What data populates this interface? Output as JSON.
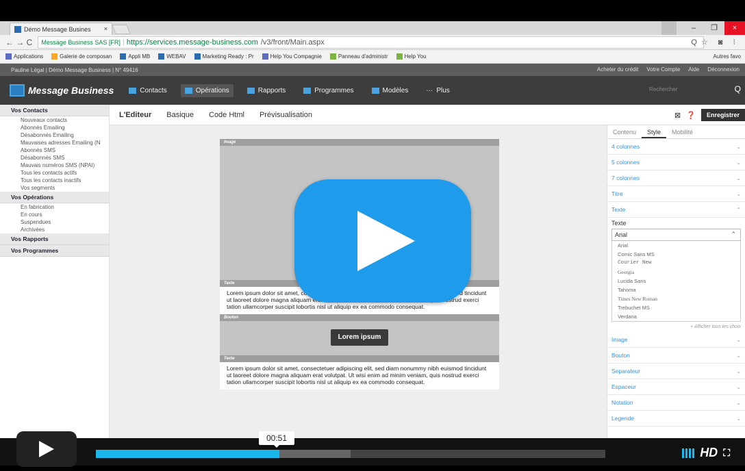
{
  "browser": {
    "tab_title": "Démo Message Busines",
    "tab_close": "×",
    "url_secure": "Message Business SAS [FR]",
    "url_host": "https://services.message-business.com",
    "url_path": "/v3/front/Main.aspx",
    "nav_icons": "← → C",
    "right_icons": "Q☆ ◙ ⁝",
    "bookmarks": [
      "Applications",
      "Galerie de composan",
      "Appli MB",
      "WEBAV",
      "Marketing Ready : Pr",
      "Help You Compagnie",
      "Panneau d'administr",
      "Help You"
    ],
    "bookmarks_right": "Autres favo",
    "win_min": "–",
    "win_max": "❐",
    "win_close": "×"
  },
  "app": {
    "info_left": "Pauline Légal | Démo Message Business | N° 49416",
    "info_credit": "Acheter du crédit",
    "info_account": "Votre Compte",
    "info_help": "Aide",
    "info_logout": "Déconnexion",
    "logo": "Message Business",
    "nav": [
      "Contacts",
      "Opérations",
      "Rapports",
      "Programmes",
      "Modèles",
      "Plus"
    ],
    "search_placeholder": "Rechercher"
  },
  "sidebar": {
    "groups": [
      {
        "title": "Vos Contacts",
        "items": [
          "Nouveaux contacts",
          "Abonnés Emailing",
          "Désabonnés Emailing",
          "Mauvaises adresses Emailing (N",
          "Abonnés SMS",
          "Désabonnés SMS",
          "Mauvais numéros SMS (NPAI)",
          "Tous les contacts actifs",
          "Tous les contacts inactifs",
          "Vos segments"
        ]
      },
      {
        "title": "Vos Opérations",
        "items": [
          "En fabrication",
          "En cours",
          "Suspendues",
          "Archivées"
        ]
      },
      {
        "title": "Vos Rapports",
        "items": []
      },
      {
        "title": "Vos Programmes",
        "items": []
      }
    ]
  },
  "editor": {
    "tabs": [
      "L'Editeur",
      "Basique",
      "Code Html",
      "Prévisualisation"
    ],
    "save_label": "Enregistrer"
  },
  "email": {
    "image_label": "Image",
    "text_label": "Texte",
    "button_label": "Bouton",
    "lorem": "Lorem ipsum dolor sit amet, consectetuer adipiscing elit, sed diam nonummy nibh euismod tincidunt ut laoreet dolore magna aliquam erat volutpat. Ut wisi enim ad minim veniam, quis nostrud exerci tation ullamcorper suscipit lobortis nisl ut aliquip ex ea commodo consequat.",
    "button_text": "Lorem ipsum"
  },
  "panel": {
    "tabs": [
      "Contenu",
      "Style",
      "Mobilité"
    ],
    "top_items": [
      "4 colonnes",
      "5 colonnes",
      "7 colonnes",
      "Titre",
      "Texte"
    ],
    "font_section": "Texte",
    "font_value": "Arial",
    "fonts": [
      "Arial",
      "Comic Sans MS",
      "Courier New",
      "Georgia",
      "Lucida Sans",
      "Tahoma",
      "Times New Roman",
      "Trebuchet MS",
      "Verdana"
    ],
    "show_all": "+ Afficher tous les choix",
    "bottom_items": [
      "Image",
      "Bouton",
      "Separateur",
      "Espaceur",
      "Notation",
      "Legende"
    ]
  },
  "video": {
    "time": "00:51",
    "progress": 0.36,
    "hd": "HD",
    "fullscreen": "⛶"
  },
  "colors": {
    "accent": "#1ab7ea",
    "yt_blue": "#1e9bea",
    "nav_dark": "#3d3d3d"
  }
}
